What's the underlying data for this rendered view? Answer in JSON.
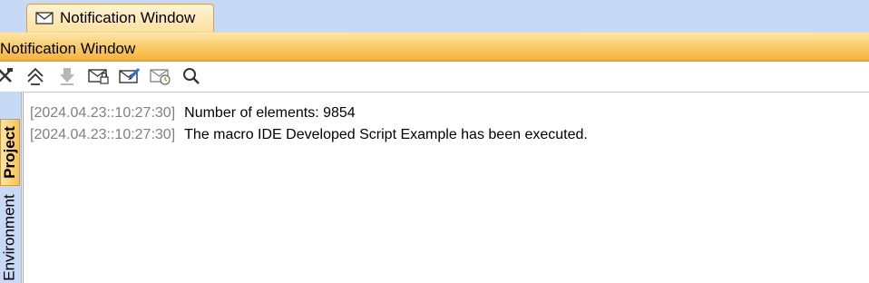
{
  "tab": {
    "label": "Notification Window",
    "icon": "envelope-icon"
  },
  "window": {
    "title": "Notification Window"
  },
  "toolbar": {
    "buttons": [
      {
        "icon": "tools-icon"
      },
      {
        "icon": "go-up-icon"
      },
      {
        "icon": "go-down-icon"
      },
      {
        "icon": "mail-lock-icon"
      },
      {
        "icon": "mail-edit-icon"
      },
      {
        "icon": "mail-clock-icon"
      },
      {
        "icon": "search-icon"
      }
    ]
  },
  "sidebar": {
    "tabs": [
      {
        "label": "Project",
        "active": true
      },
      {
        "label": "Environment",
        "active": false
      }
    ]
  },
  "messages": [
    {
      "timestamp": "[2024.04.23::10:27:30]",
      "text": "Number of elements: 9854"
    },
    {
      "timestamp": "[2024.04.23::10:27:30]",
      "text": "The macro IDE Developed Script Example has been executed."
    }
  ],
  "colors": {
    "tabstrip": "#c6daf7",
    "titlebar": "#f9c964",
    "timestamp": "#808080"
  }
}
